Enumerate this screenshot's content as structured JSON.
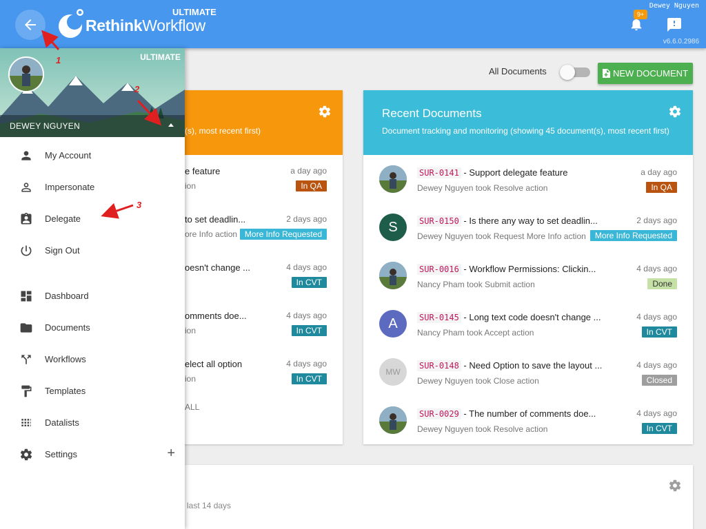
{
  "header": {
    "brand_bold": "Rethink",
    "brand_rest": "Workflow",
    "edition": "ULTIMATE",
    "user_name": "Dewey Nguyen",
    "version": "v6.6.0.2986",
    "notification_count": "9+"
  },
  "toolbar": {
    "all_documents_label": "All Documents",
    "all_documents_on": false,
    "new_document_label": "NEW DOCUMENT"
  },
  "left_card": {
    "subtitle_partial": "nt(s), most recent first)",
    "color": "#f7970c",
    "rows": [
      {
        "title": "e feature",
        "sub": "ion",
        "time": "a day ago",
        "status": "In QA",
        "status_color": "#b85410"
      },
      {
        "title": "to set deadlin...",
        "sub": "ore Info action",
        "time": "2 days ago",
        "status": "More Info Requested",
        "status_color": "#3ab6d6"
      },
      {
        "title": "oesn't change ...",
        "sub": "",
        "time": "4 days ago",
        "status": "In CVT",
        "status_color": "#1f8a9e"
      },
      {
        "title": "omments doe...",
        "sub": "ion",
        "time": "4 days ago",
        "status": "In CVT",
        "status_color": "#1f8a9e"
      },
      {
        "title": "elect all option",
        "sub": "ion",
        "time": "4 days ago",
        "status": "In CVT",
        "status_color": "#1f8a9e"
      }
    ],
    "footer_partial": "ALL"
  },
  "recent": {
    "title": "Recent Documents",
    "subtitle": "Document tracking and monitoring (showing 45 document(s), most recent first)",
    "color": "#3bbcd8",
    "rows": [
      {
        "code": "SUR-0141",
        "title": "- Support delegate feature",
        "sub": "Dewey Nguyen took Resolve action",
        "time": "a day ago",
        "status": "In QA",
        "status_color": "#b85410",
        "avatar": "photo"
      },
      {
        "code": "SUR-0150",
        "title": "- Is there any way to set deadlin...",
        "sub": "Dewey Nguyen took Request More Info action",
        "time": "2 days ago",
        "status": "More Info Requested",
        "status_color": "#3ab6d6",
        "avatar": "S",
        "avatar_color": "#1f5d4b"
      },
      {
        "code": "SUR-0016",
        "title": "- Workflow Permissions: Clickin...",
        "sub": "Nancy Pham took Submit action",
        "time": "4 days ago",
        "status": "Done",
        "status_color": "#c5e1a5",
        "status_text": "#333",
        "avatar": "photo"
      },
      {
        "code": "SUR-0145",
        "title": "- Long text code doesn't change ...",
        "sub": "Nancy Pham took Accept action",
        "time": "4 days ago",
        "status": "In CVT",
        "status_color": "#1f8a9e",
        "avatar": "A",
        "avatar_color": "#5c6bc0"
      },
      {
        "code": "SUR-0148",
        "title": "- Need Option to save the layout ...",
        "sub": "Dewey Nguyen took Close action",
        "time": "4 days ago",
        "status": "Closed",
        "status_color": "#9e9e9e",
        "avatar": "MW",
        "avatar_color": "#d7d7d7"
      },
      {
        "code": "SUR-0029",
        "title": "- The number of comments doe...",
        "sub": "Dewey Nguyen took Resolve action",
        "time": "4 days ago",
        "status": "In CVT",
        "status_color": "#1f8a9e",
        "avatar": "photo"
      }
    ]
  },
  "bottom_card": {
    "subtitle_partial": "last 14 days"
  },
  "drawer": {
    "edition": "ULTIMATE",
    "user_name": "DEWEY NGUYEN",
    "account_items": [
      {
        "label": "My Account",
        "icon": "person-icon"
      },
      {
        "label": "Impersonate",
        "icon": "person-outline-icon"
      },
      {
        "label": "Delegate",
        "icon": "assignment-ind-icon"
      },
      {
        "label": "Sign Out",
        "icon": "power-icon"
      }
    ],
    "nav_items": [
      {
        "label": "Dashboard",
        "icon": "dashboard-icon"
      },
      {
        "label": "Documents",
        "icon": "folder-icon"
      },
      {
        "label": "Workflows",
        "icon": "call-split-icon"
      },
      {
        "label": "Templates",
        "icon": "paint-roller-icon"
      },
      {
        "label": "Datalists",
        "icon": "grid-icon"
      },
      {
        "label": "Settings",
        "icon": "gear-icon",
        "expandable": true
      }
    ]
  },
  "annotations": [
    "1",
    "2",
    "3"
  ]
}
